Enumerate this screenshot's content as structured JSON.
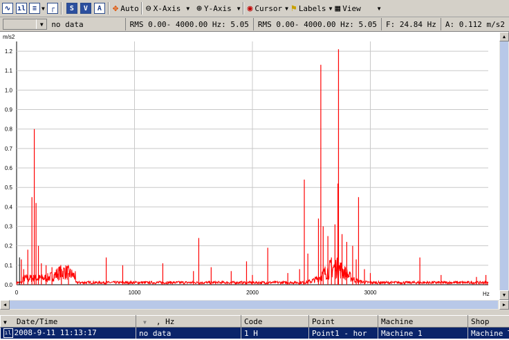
{
  "toolbar": {
    "auto_label": "Auto",
    "xaxis_label": "X-Axis",
    "yaxis_label": "Y-Axis",
    "cursor_label": "Cursor",
    "labels_label": "Labels",
    "view_label": "View",
    "icons": [
      "waveform-icon",
      "spectrum-icon",
      "waterfall-icon",
      "trend-icon",
      "s-icon",
      "v-icon",
      "a-icon",
      "auto-icon",
      "x-axis-icon",
      "y-axis-icon",
      "cursor-icon",
      "labels-icon",
      "view-icon"
    ]
  },
  "info": {
    "combo_value": "no data",
    "rms1": "RMS 0.00- 4000.00 Hz: 5.05",
    "rms2": "RMS 0.00- 4000.00 Hz: 5.05",
    "freq": "F: 24.84 Hz",
    "amp": "A: 0.112 m/s2"
  },
  "chart_data": {
    "type": "line",
    "ylabel": "m/s2",
    "xlabel": "Hz",
    "xlim": [
      0,
      4000
    ],
    "ylim": [
      0,
      1.25
    ],
    "xticks": [
      0,
      1000,
      2000,
      3000
    ],
    "yticks": [
      0.0,
      0.1,
      0.2,
      0.3,
      0.4,
      0.5,
      0.6,
      0.7,
      0.8,
      0.9,
      1.0,
      1.1,
      1.2
    ],
    "ytick_labels": [
      "0.0",
      "0.1",
      "0.2",
      "0.3",
      "0.4",
      "0.5",
      "0.6",
      "0.7",
      "0.8",
      "0.9",
      "1.0",
      "1.1",
      "1.2"
    ],
    "grid": true,
    "color": "#ff0000",
    "cursor_x": 24.84,
    "cursor_y": 0.112,
    "peaks": [
      [
        40,
        0.13
      ],
      [
        60,
        0.08
      ],
      [
        95,
        0.18
      ],
      [
        130,
        0.45
      ],
      [
        150,
        0.8
      ],
      [
        165,
        0.42
      ],
      [
        185,
        0.2
      ],
      [
        210,
        0.11
      ],
      [
        250,
        0.1
      ],
      [
        300,
        0.09
      ],
      [
        380,
        0.08
      ],
      [
        440,
        0.06
      ],
      [
        760,
        0.14
      ],
      [
        900,
        0.1
      ],
      [
        1240,
        0.11
      ],
      [
        1500,
        0.07
      ],
      [
        1545,
        0.24
      ],
      [
        1650,
        0.09
      ],
      [
        1820,
        0.07
      ],
      [
        1950,
        0.12
      ],
      [
        2000,
        0.05
      ],
      [
        2130,
        0.19
      ],
      [
        2300,
        0.06
      ],
      [
        2400,
        0.08
      ],
      [
        2440,
        0.54
      ],
      [
        2470,
        0.16
      ],
      [
        2560,
        0.34
      ],
      [
        2580,
        1.13
      ],
      [
        2600,
        0.3
      ],
      [
        2640,
        0.25
      ],
      [
        2670,
        0.14
      ],
      [
        2700,
        0.31
      ],
      [
        2725,
        0.52
      ],
      [
        2730,
        1.21
      ],
      [
        2760,
        0.26
      ],
      [
        2800,
        0.22
      ],
      [
        2850,
        0.2
      ],
      [
        2880,
        0.13
      ],
      [
        2900,
        0.45
      ],
      [
        2950,
        0.08
      ],
      [
        3000,
        0.06
      ],
      [
        3420,
        0.14
      ],
      [
        3600,
        0.05
      ],
      [
        3900,
        0.04
      ],
      [
        3980,
        0.05
      ]
    ]
  },
  "grid_table": {
    "headers": [
      "Date/Time",
      ", Hz",
      "Code",
      "Point",
      "Machine",
      "Shop"
    ],
    "rows": [
      [
        "2008-9-11 11:13:17",
        "no data",
        "1 H",
        "Point1 - hor",
        "Machine 1",
        "Machine T"
      ]
    ]
  }
}
